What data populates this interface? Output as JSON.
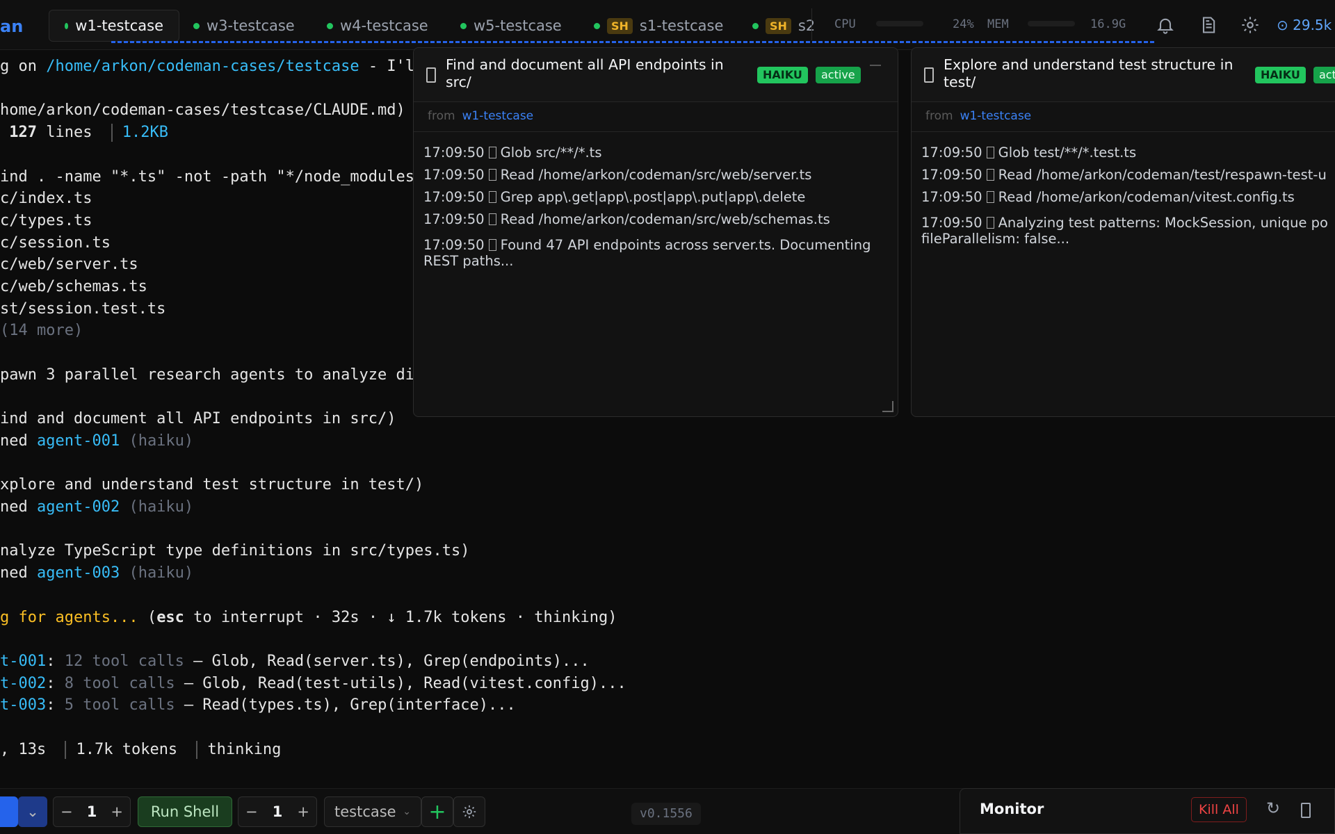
{
  "header": {
    "brand": "an",
    "tabs": [
      {
        "label": "w1-testcase",
        "active": true
      },
      {
        "label": "w3-testcase"
      },
      {
        "label": "w4-testcase"
      },
      {
        "label": "w5-testcase"
      },
      {
        "label": "s1-testcase",
        "badge": "SH"
      },
      {
        "label": "s2",
        "badge": "SH"
      }
    ],
    "stats": {
      "cpu_label": "CPU",
      "cpu_value": "24%",
      "mem_label": "MEM",
      "mem_value": "16.9G",
      "tokens": "29.5k"
    }
  },
  "terminal": {
    "lines": [
      [
        {
          "t": "g on "
        },
        {
          "t": "/home/arkon/codeman-cases/testcase",
          "c": "cyan"
        },
        {
          "t": " - I'l"
        }
      ],
      [
        {
          "t": ""
        }
      ],
      [
        {
          "t": "home/arkon/codeman-cases/testcase/CLAUDE.md)"
        }
      ],
      [
        {
          "t": " "
        },
        {
          "t": "127",
          "c": "bold"
        },
        {
          "t": " lines "
        },
        {
          "sep": true
        },
        {
          "t": "1.2KB",
          "c": "cyan"
        }
      ],
      [
        {
          "t": ""
        }
      ],
      [
        {
          "t": "ind . -name \"*.ts\" -not -path \"*/node_modules"
        }
      ],
      [
        {
          "t": "c/index.ts"
        }
      ],
      [
        {
          "t": "c/types.ts"
        }
      ],
      [
        {
          "t": "c/session.ts"
        }
      ],
      [
        {
          "t": "c/web/server.ts"
        }
      ],
      [
        {
          "t": "c/web/schemas.ts"
        }
      ],
      [
        {
          "t": "st/session.test.ts"
        }
      ],
      [
        {
          "t": "(14 more)",
          "c": "gray"
        }
      ],
      [
        {
          "t": ""
        }
      ],
      [
        {
          "t": "pawn 3 parallel research agents to analyze di"
        }
      ],
      [
        {
          "t": ""
        }
      ],
      [
        {
          "t": "ind and document all API endpoints in src/)"
        }
      ],
      [
        {
          "t": "ned "
        },
        {
          "t": "agent-001",
          "c": "cyan"
        },
        {
          "t": " (haiku)",
          "c": "gray"
        }
      ],
      [
        {
          "t": ""
        }
      ],
      [
        {
          "t": "xplore and understand test structure in test/)"
        }
      ],
      [
        {
          "t": "ned "
        },
        {
          "t": "agent-002",
          "c": "cyan"
        },
        {
          "t": " (haiku)",
          "c": "gray"
        }
      ],
      [
        {
          "t": ""
        }
      ],
      [
        {
          "t": "nalyze TypeScript type definitions in src/types.ts)"
        }
      ],
      [
        {
          "t": "ned "
        },
        {
          "t": "agent-003",
          "c": "cyan"
        },
        {
          "t": " (haiku)",
          "c": "gray"
        }
      ],
      [
        {
          "t": ""
        }
      ],
      [
        {
          "t": "g for agents...",
          "c": "yellow"
        },
        {
          "t": " ("
        },
        {
          "t": "esc",
          "c": "bold"
        },
        {
          "t": " to interrupt · 32s · ↓ 1.7k tokens · thinking)"
        }
      ],
      [
        {
          "t": ""
        }
      ],
      [
        {
          "t": "t-001",
          "c": "cyan"
        },
        {
          "t": ": "
        },
        {
          "t": "12 tool calls",
          "c": "gray"
        },
        {
          "t": " — Glob, Read(server.ts), Grep(endpoints)..."
        }
      ],
      [
        {
          "t": "t-002",
          "c": "cyan"
        },
        {
          "t": ": "
        },
        {
          "t": "8 tool calls",
          "c": "gray"
        },
        {
          "t": " — Glob, Read(test-utils), Read(vitest.config)..."
        }
      ],
      [
        {
          "t": "t-003",
          "c": "cyan"
        },
        {
          "t": ": "
        },
        {
          "t": "5 tool calls",
          "c": "gray"
        },
        {
          "t": " — Read(types.ts), Grep(interface)..."
        }
      ],
      [
        {
          "t": ""
        }
      ],
      [
        {
          "t": ", 13s "
        },
        {
          "sep": true
        },
        {
          "t": "1.7k tokens "
        },
        {
          "sep": true
        },
        {
          "t": "thinking"
        }
      ]
    ]
  },
  "agents": [
    {
      "title": "Find and document all API endpoints in src/",
      "model": "HAIKU",
      "status": "active",
      "from_label": "from",
      "from_session": "w1-testcase",
      "logs": [
        {
          "time": "17:09:50",
          "text": "Glob src/**/*.ts"
        },
        {
          "time": "17:09:50",
          "text": "Read /home/arkon/codeman/src/web/server.ts"
        },
        {
          "time": "17:09:50",
          "text": "Grep app\\.get|app\\.post|app\\.put|app\\.delete"
        },
        {
          "time": "17:09:50",
          "text": "Read /home/arkon/codeman/src/web/schemas.ts"
        },
        {
          "time": "17:09:50",
          "text": "Found 47 API endpoints across server.ts. Documenting REST paths..."
        }
      ]
    },
    {
      "title": "Explore and understand test structure in test/",
      "model": "HAIKU",
      "status": "act",
      "from_label": "from",
      "from_session": "w1-testcase",
      "logs": [
        {
          "time": "17:09:50",
          "text": "Glob test/**/*.test.ts"
        },
        {
          "time": "17:09:50",
          "text": "Read /home/arkon/codeman/test/respawn-test-u"
        },
        {
          "time": "17:09:50",
          "text": "Read /home/arkon/codeman/vitest.config.ts"
        },
        {
          "time": "17:09:50",
          "text": "Analyzing test patterns: MockSession, unique po fileParallelism: false..."
        }
      ]
    }
  ],
  "footer": {
    "count1": "1",
    "run_shell": "Run Shell",
    "count2": "1",
    "case_select": "testcase",
    "version": "v0.1556",
    "monitor_title": "Monitor",
    "kill_all": "Kill All"
  },
  "colors": {
    "accent": "#3b82f6",
    "active_green": "#22c55e",
    "terminal_cyan": "#38bdf8",
    "waiting_yellow": "#fbbf24"
  }
}
